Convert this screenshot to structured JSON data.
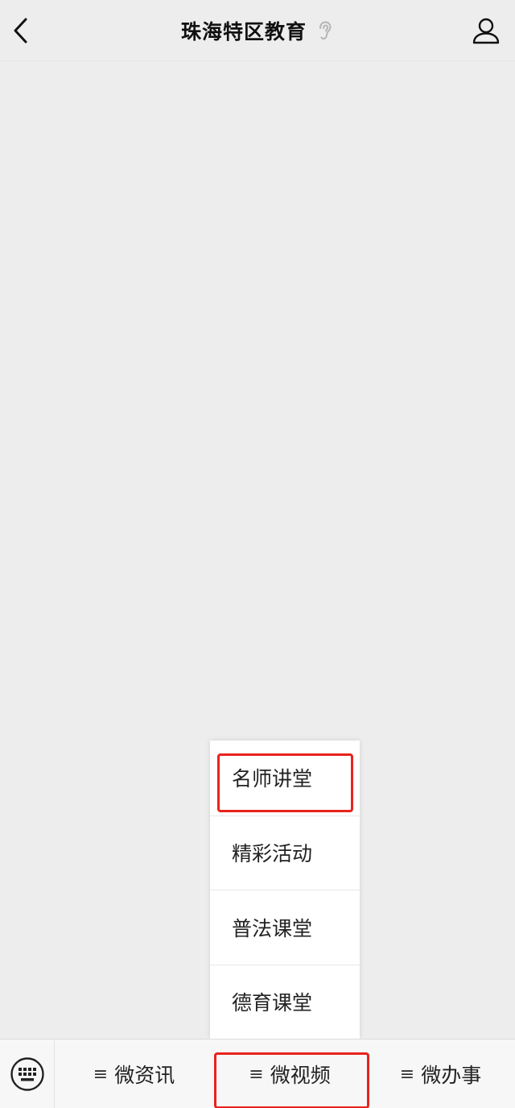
{
  "header": {
    "title": "珠海特区教育",
    "back_icon": "chevron-left-icon",
    "ear_icon": "ear-icon",
    "profile_icon": "user-profile-icon"
  },
  "submenu": {
    "items": [
      {
        "label": "名师讲堂",
        "highlighted": true
      },
      {
        "label": "精彩活动"
      },
      {
        "label": "普法课堂"
      },
      {
        "label": "德育课堂"
      }
    ]
  },
  "bottom_bar": {
    "keyboard_icon": "keyboard-icon",
    "menu_glyph": "≡",
    "tabs": [
      {
        "label": "微资讯"
      },
      {
        "label": "微视频",
        "highlighted": true
      },
      {
        "label": "微办事"
      }
    ]
  },
  "colors": {
    "background": "#ededed",
    "highlight": "#e8231c"
  }
}
